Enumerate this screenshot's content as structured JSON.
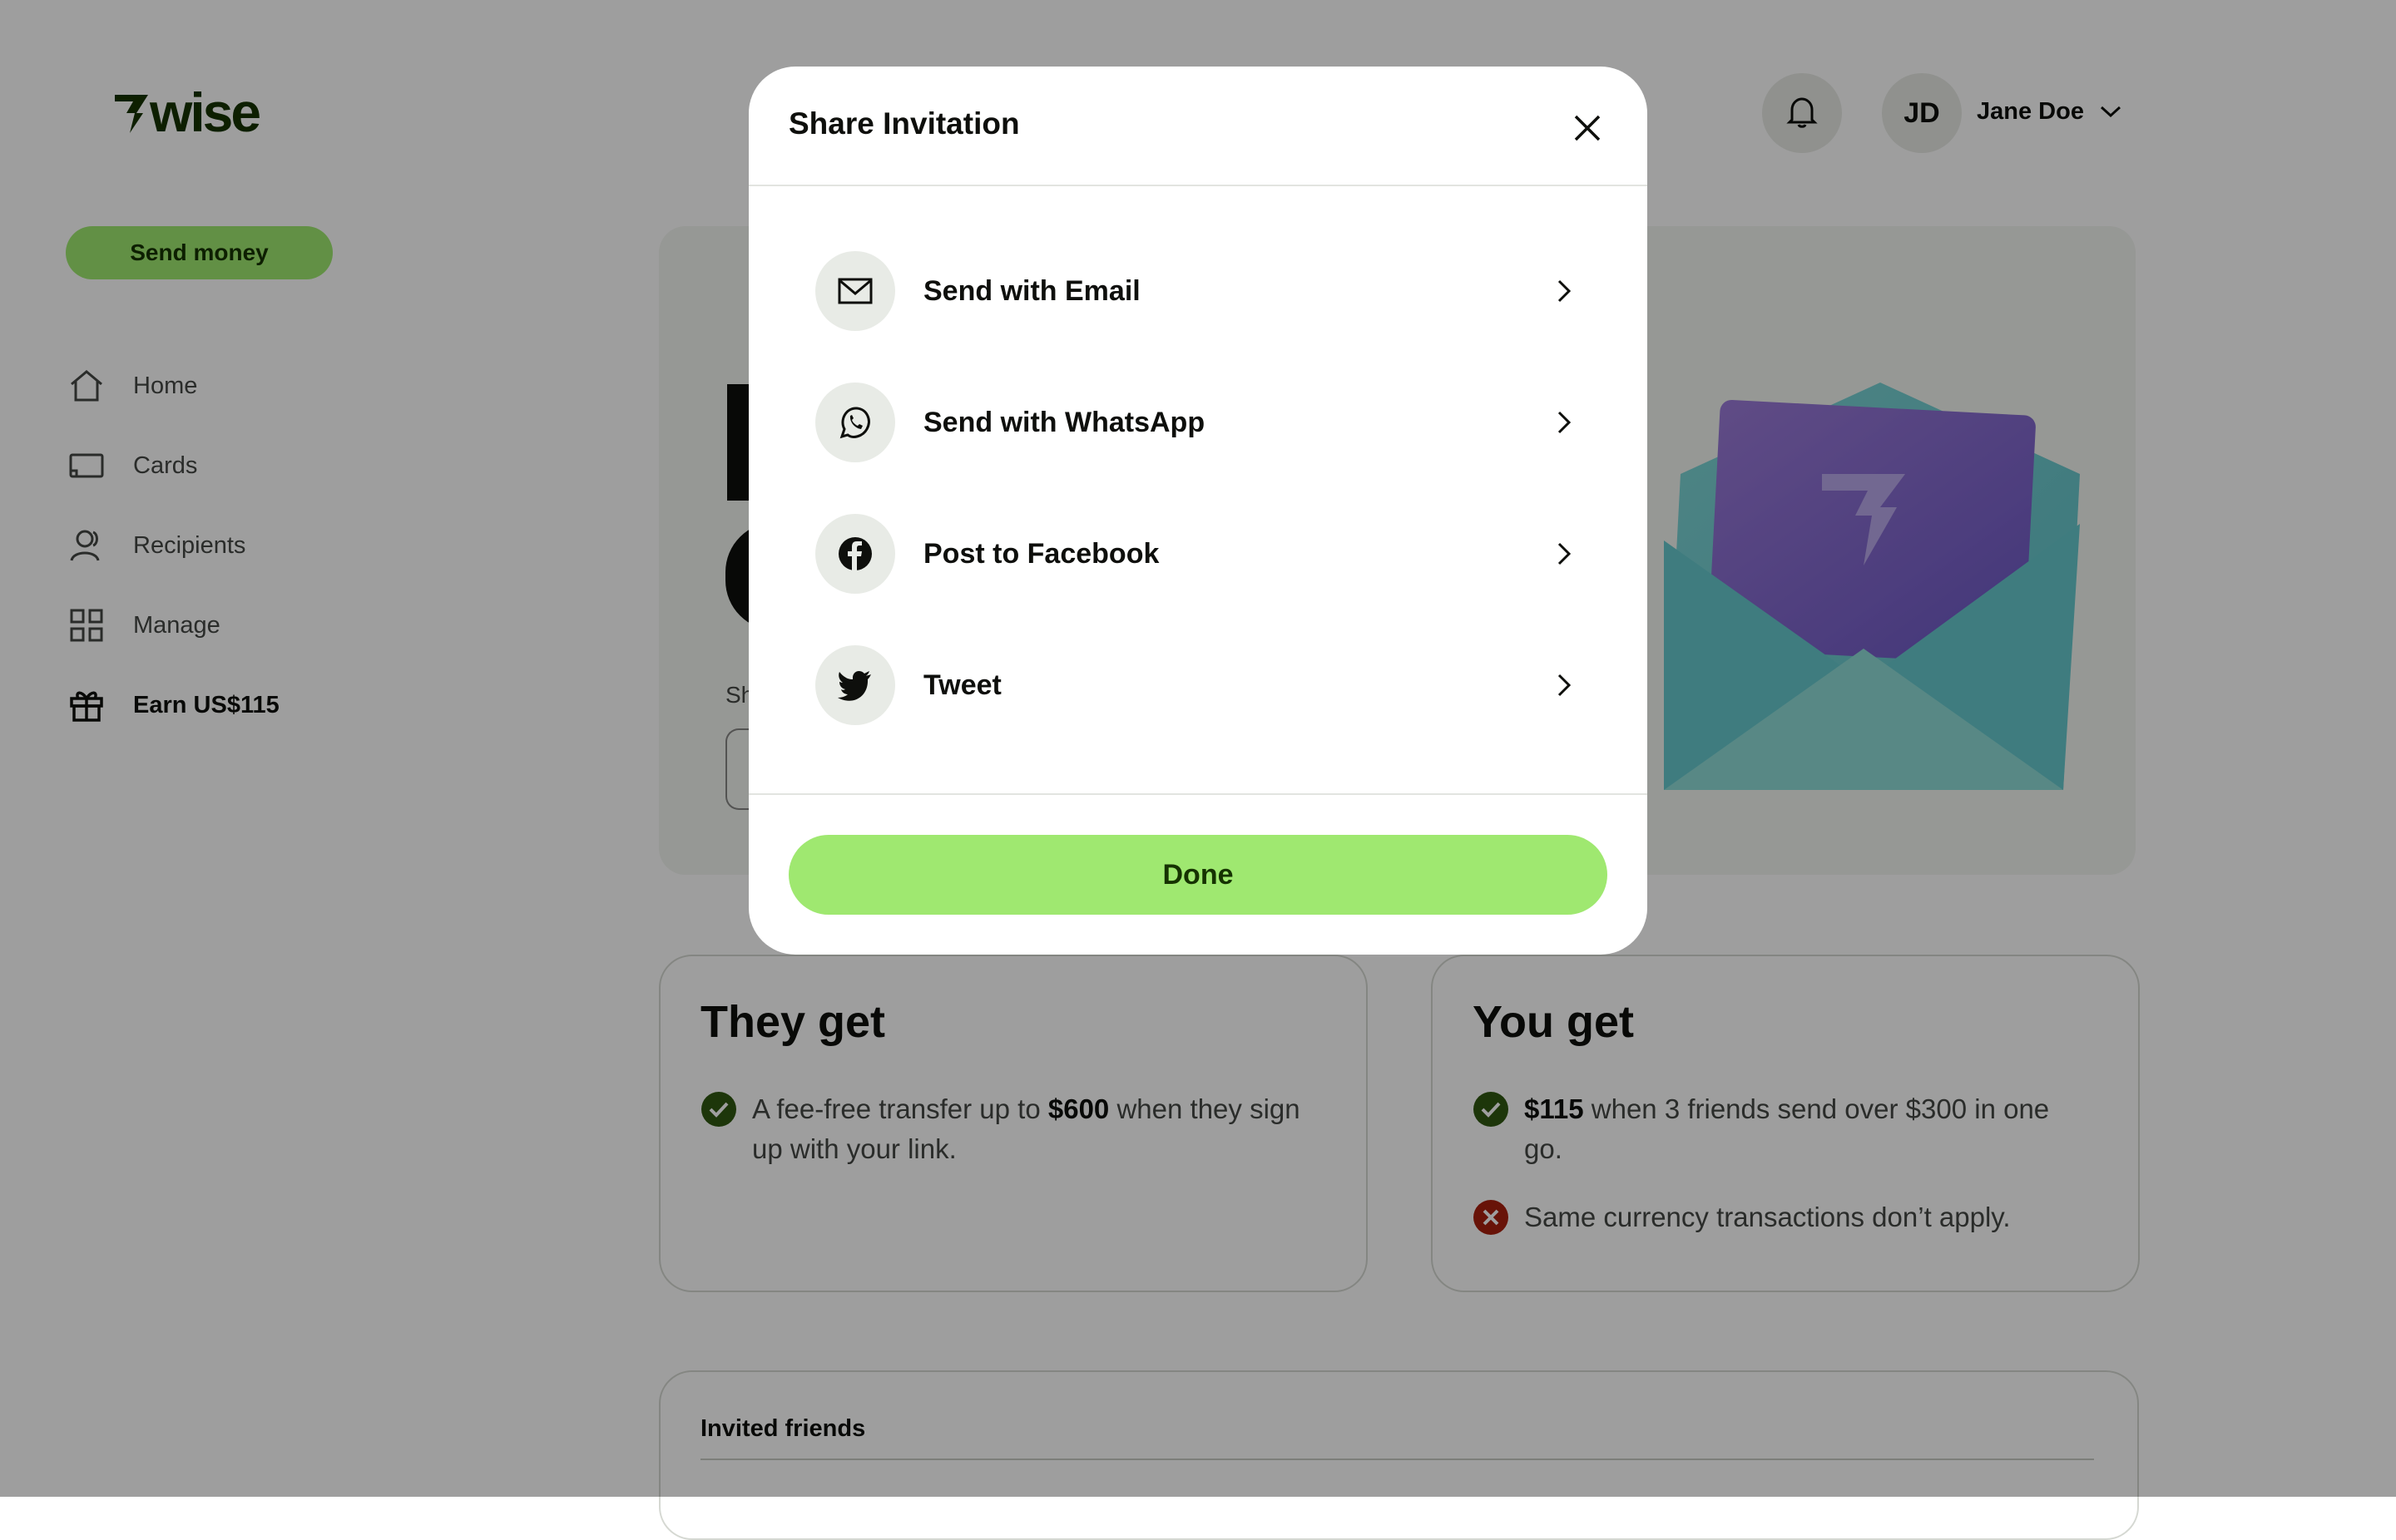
{
  "brand": {
    "logo_text": "7wise",
    "accent": "#9fe870",
    "accent_text": "#163300"
  },
  "sidebar": {
    "send_money_label": "Send money",
    "items": [
      {
        "label": "Home",
        "icon": "home-icon"
      },
      {
        "label": "Cards",
        "icon": "card-icon"
      },
      {
        "label": "Recipients",
        "icon": "recipients-icon"
      },
      {
        "label": "Manage",
        "icon": "grid-icon"
      },
      {
        "label": "Earn US$115",
        "icon": "gift-icon",
        "active": true
      }
    ]
  },
  "header": {
    "notifications_icon": "bell-icon",
    "avatar_initials": "JD",
    "user_name": "Jane Doe"
  },
  "hero": {
    "partial_text": "Sh"
  },
  "they_get": {
    "title": "They get",
    "bullets": [
      {
        "icon": "check-circle-icon",
        "prefix": "A fee-free transfer up to ",
        "bold": "$600",
        "suffix": " when they sign up with your link."
      }
    ]
  },
  "you_get": {
    "title": "You get",
    "bullets": [
      {
        "icon": "check-circle-icon",
        "bold": "$115",
        "suffix": " when 3 friends send over $300 in one go."
      },
      {
        "icon": "x-circle-icon",
        "text": "Same currency transactions don’t apply."
      }
    ]
  },
  "invited": {
    "title": "Invited friends"
  },
  "modal": {
    "title": "Share Invitation",
    "close_icon": "close-icon",
    "options": [
      {
        "label": "Send with Email",
        "icon": "email-icon"
      },
      {
        "label": "Send with WhatsApp",
        "icon": "whatsapp-icon"
      },
      {
        "label": "Post to Facebook",
        "icon": "facebook-icon"
      },
      {
        "label": "Tweet",
        "icon": "twitter-icon"
      }
    ],
    "done_label": "Done"
  }
}
